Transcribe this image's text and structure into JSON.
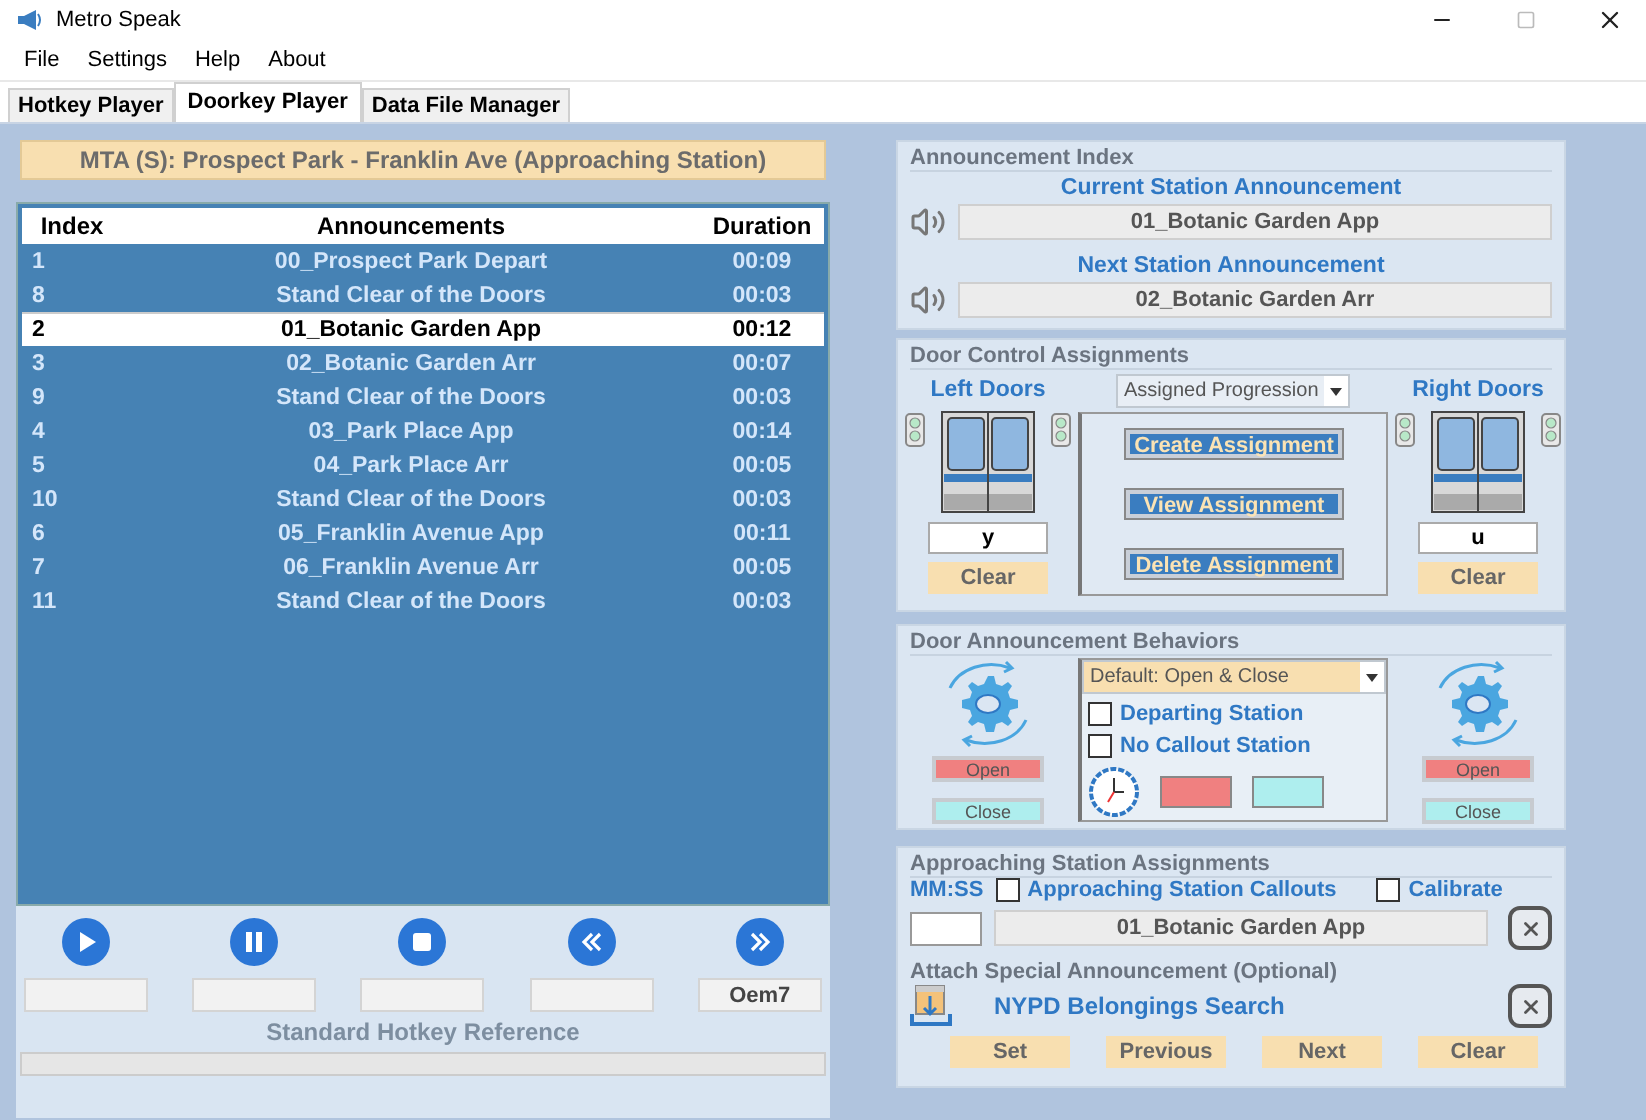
{
  "window": {
    "title": "Metro Speak"
  },
  "menu": [
    "File",
    "Settings",
    "Help",
    "About"
  ],
  "tabs": [
    {
      "label": "Hotkey Player",
      "selected": false
    },
    {
      "label": "Doorkey Player",
      "selected": true
    },
    {
      "label": "Data File Manager",
      "selected": false
    }
  ],
  "route_banner": "MTA (S): Prospect Park - Franklin Ave (Approaching Station)",
  "table": {
    "columns": [
      "Index",
      "Announcements",
      "Duration"
    ],
    "rows": [
      {
        "index": "1",
        "announcement": "00_Prospect Park Depart",
        "duration": "00:09",
        "selected": false
      },
      {
        "index": "8",
        "announcement": "Stand Clear of the Doors",
        "duration": "00:03",
        "selected": false
      },
      {
        "index": "2",
        "announcement": "01_Botanic Garden App",
        "duration": "00:12",
        "selected": true
      },
      {
        "index": "3",
        "announcement": "02_Botanic Garden Arr",
        "duration": "00:07",
        "selected": false
      },
      {
        "index": "9",
        "announcement": "Stand Clear of the Doors",
        "duration": "00:03",
        "selected": false
      },
      {
        "index": "4",
        "announcement": "03_Park Place App",
        "duration": "00:14",
        "selected": false
      },
      {
        "index": "5",
        "announcement": "04_Park Place Arr",
        "duration": "00:05",
        "selected": false
      },
      {
        "index": "10",
        "announcement": "Stand Clear of the Doors",
        "duration": "00:03",
        "selected": false
      },
      {
        "index": "6",
        "announcement": "05_Franklin Avenue App",
        "duration": "00:11",
        "selected": false
      },
      {
        "index": "7",
        "announcement": "06_Franklin Avenue Arr",
        "duration": "00:05",
        "selected": false
      },
      {
        "index": "11",
        "announcement": "Stand Clear of the Doors",
        "duration": "00:03",
        "selected": false
      }
    ]
  },
  "transport": [
    {
      "kind": "play"
    },
    {
      "kind": "pause"
    },
    {
      "kind": "stop"
    },
    {
      "kind": "rewind"
    },
    {
      "kind": "forward",
      "hotkey": "Oem7"
    }
  ],
  "hotkey_reference": "Standard Hotkey Reference",
  "progress": {
    "level": 0
  },
  "announcement_index": {
    "title": "Announcement Index",
    "current_label": "Current Station Announcement",
    "current_value": "01_Botanic Garden App",
    "next_label": "Next Station Announcement",
    "next_value": "02_Botanic Garden Arr"
  },
  "door_control": {
    "title": "Door Control Assignments",
    "left_label": "Left Doors",
    "right_label": "Right Doors",
    "progression": "Assigned Progression",
    "buttons": [
      "Create Assignment",
      "View Assignment",
      "Delete Assignment"
    ],
    "left_key": "y",
    "right_key": "u",
    "left_clear": "Clear",
    "right_clear": "Clear"
  },
  "door_behaviors": {
    "title": "Door Announcement Behaviors",
    "mode": "Default: Open & Close",
    "checkboxes": [
      {
        "label": "Departing Station",
        "checked": false
      },
      {
        "label": "No Callout Station",
        "checked": false
      }
    ],
    "left_open": "Open",
    "left_close": "Close",
    "right_open": "Open",
    "right_close": "Close"
  },
  "approaching": {
    "title": "Approaching Station Assignments",
    "time_label": "MM:SS",
    "callouts": {
      "label": "Approaching Station Callouts",
      "checked": false
    },
    "calibrate": {
      "label": "Calibrate",
      "checked": false
    },
    "announcement": "01_Botanic Garden App"
  },
  "special": {
    "title": "Attach Special Announcement (Optional)",
    "name": "NYPD Belongings Search",
    "buttons": [
      "Set",
      "Previous",
      "Next",
      "Clear"
    ]
  }
}
